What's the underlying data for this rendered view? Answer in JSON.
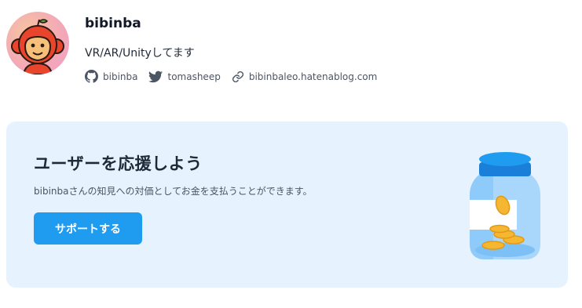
{
  "profile": {
    "name": "bibinba",
    "bio": "VR/AR/Unityしてます",
    "links": [
      {
        "icon": "github-icon",
        "label": "bibinba"
      },
      {
        "icon": "twitter-icon",
        "label": "tomasheep"
      },
      {
        "icon": "link-icon",
        "label": "bibinbaleo.hatenablog.com"
      }
    ]
  },
  "support_card": {
    "title": "ユーザーを応援しよう",
    "description": "bibinbaさんの知見への対価としてお金を支払うことができます。",
    "button_label": "サポートする"
  },
  "colors": {
    "accent": "#1f9cf0",
    "card_background": "#e6f2fe",
    "avatar_background": "#f3a7b8"
  }
}
